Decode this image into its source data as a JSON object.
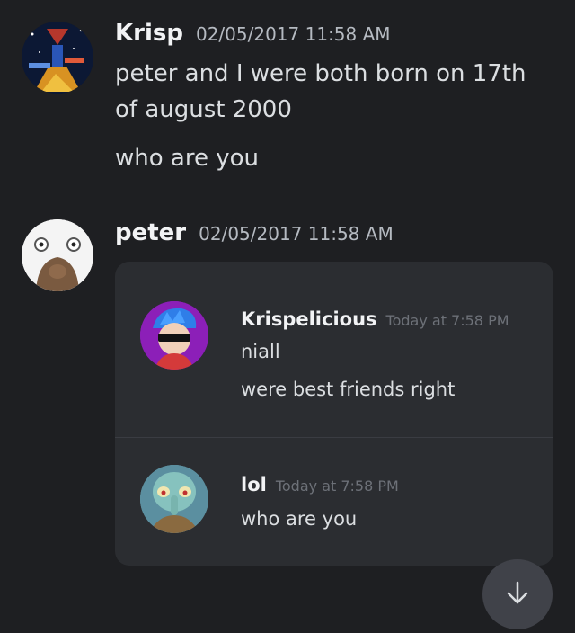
{
  "messages": [
    {
      "username": "Krisp",
      "timestamp": "02/05/2017 11:58 AM",
      "avatar_icon": "star-wars-poster-avatar",
      "lines": [
        "peter and I were both born on 17th",
        "of august 2000"
      ],
      "followup": "who are you"
    },
    {
      "username": "peter",
      "timestamp": "02/05/2017 11:58 AM",
      "avatar_icon": "cartoon-bird-avatar"
    }
  ],
  "embed": {
    "items": [
      {
        "username": "Krispelicious",
        "timestamp": "Today at 7:58 PM",
        "lines": [
          "niall",
          "were best friends right"
        ],
        "avatar_icon": "blue-hair-sunglasses-avatar",
        "avatar_color": "#8c1fb8"
      },
      {
        "username": "lol",
        "timestamp": "Today at 7:58 PM",
        "lines": [
          "who are you"
        ],
        "avatar_icon": "squidward-avatar"
      }
    ]
  },
  "scroll_button_icon": "arrow-down-icon",
  "colors": {
    "background": "#1e1f22",
    "embed_background": "#2b2d31",
    "accent_purple": "#8c1fb8"
  }
}
